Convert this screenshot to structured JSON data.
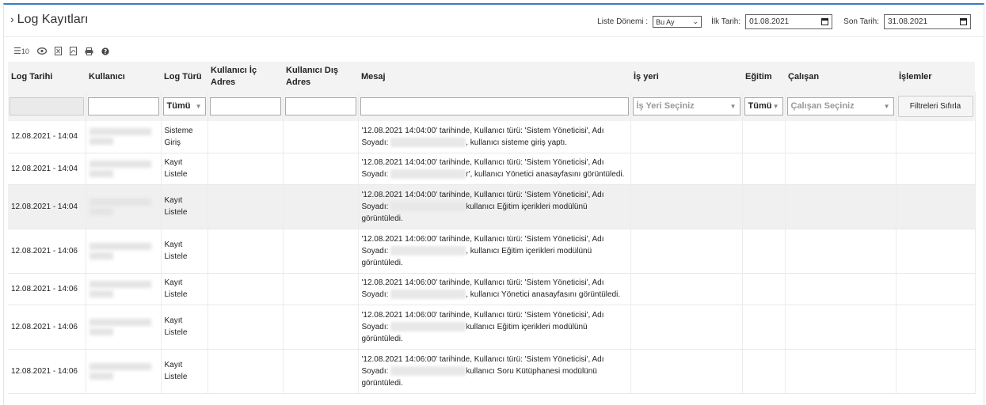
{
  "header": {
    "title": "Log Kayıtları",
    "period_label": "Liste Dönemi :",
    "period_value": "Bu Ay",
    "start_label": "İlk Tarih:",
    "start_value": "01.08.2021",
    "end_label": "Son Tarih:",
    "end_value": "31.08.2021"
  },
  "toolbar": {
    "page_size": "10"
  },
  "columns": [
    "Log Tarihi",
    "Kullanıcı",
    "Log Türü",
    "Kullanıcı İç Adres",
    "Kullanıcı Dış Adres",
    "Mesaj",
    "İş yeri",
    "Eğitim",
    "Çalışan",
    "İşlemler"
  ],
  "filters": {
    "log_type": "Tümü",
    "workplace_placeholder": "İş Yeri Seçiniz",
    "training": "Tümü",
    "employee_placeholder": "Çalışan Seçiniz",
    "reset_label": "Filtreleri Sıfırla"
  },
  "rows": [
    {
      "date": "12.08.2021 - 14:04",
      "type": "Sisteme Giriş",
      "msg_a": "'12.08.2021 14:04:00' tarihinde, Kullanıcı türü: 'Sistem Yöneticisi', Adı Soyadı:",
      "msg_b": ", kullanıcı sisteme giriş yaptı."
    },
    {
      "date": "12.08.2021 - 14:04",
      "type": "Kayıt Listele",
      "msg_a": "'12.08.2021 14:04:00' tarihinde, Kullanıcı türü: 'Sistem Yöneticisi', Adı Soyadı:",
      "msg_b": "r', kullanıcı Yönetici anasayfasını görüntüledi."
    },
    {
      "date": "12.08.2021 - 14:04",
      "type": "Kayıt Listele",
      "msg_a": "'12.08.2021 14:04:00' tarihinde, Kullanıcı türü: 'Sistem Yöneticisi', Adı Soyadı:",
      "msg_b": "kullanıcı Eğitim içerikleri modülünü görüntüledi."
    },
    {
      "date": "12.08.2021 - 14:06",
      "type": "Kayıt Listele",
      "msg_a": "'12.08.2021 14:06:00' tarihinde, Kullanıcı türü: 'Sistem Yöneticisi', Adı Soyadı:",
      "msg_b": ", kullanıcı Eğitim içerikleri modülünü görüntüledi."
    },
    {
      "date": "12.08.2021 - 14:06",
      "type": "Kayıt Listele",
      "msg_a": "'12.08.2021 14:06:00' tarihinde, Kullanıcı türü: 'Sistem Yöneticisi', Adı Soyadı:",
      "msg_b": ", kullanıcı Yönetici anasayfasını görüntüledi."
    },
    {
      "date": "12.08.2021 - 14:06",
      "type": "Kayıt Listele",
      "msg_a": "'12.08.2021 14:06:00' tarihinde, Kullanıcı türü: 'Sistem Yöneticisi', Adı Soyadı:",
      "msg_b": "kullanıcı Eğitim içerikleri modülünü görüntüledi."
    },
    {
      "date": "12.08.2021 - 14:06",
      "type": "Kayıt Listele",
      "msg_a": "'12.08.2021 14:06:00' tarihinde, Kullanıcı türü: 'Sistem Yöneticisi', Adı Soyadı:",
      "msg_b": "kullanıcı Soru Kütüphanesi modülünü görüntüledi."
    }
  ]
}
